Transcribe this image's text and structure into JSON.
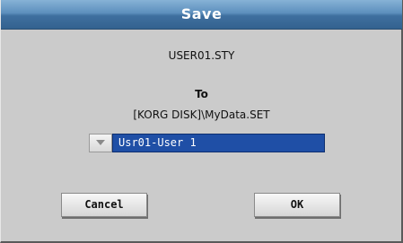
{
  "dialog": {
    "title": "Save",
    "filename": "USER01.STY",
    "to_label": "To",
    "destination_path": "[KORG DISK]\\MyData.SET",
    "target_select": {
      "value": "Usr01-User 1"
    },
    "buttons": {
      "cancel": "Cancel",
      "ok": "OK"
    }
  },
  "colors": {
    "title_bar": "#4f80b0",
    "selected_field": "#1f4fa6",
    "background": "#cbcbcb"
  },
  "icons": {
    "select_arrow": "chevron-down-icon"
  }
}
